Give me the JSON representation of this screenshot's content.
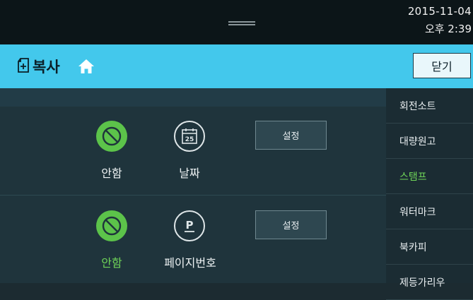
{
  "status": {
    "date": "2015-11-04",
    "time": "오후 2:39"
  },
  "header": {
    "title": "복사",
    "close_label": "닫기"
  },
  "stamp_rows": [
    {
      "none_label": "안함",
      "option_label": "날짜",
      "option_icon": "calendar-25-icon",
      "calendar_day": "25",
      "settings_label": "설정",
      "none_active": false
    },
    {
      "none_label": "안함",
      "option_label": "페이지번호",
      "option_icon": "page-number-p-icon",
      "page_symbol": "P",
      "settings_label": "설정",
      "none_active": true
    }
  ],
  "menu": {
    "items": [
      {
        "label": "회전소트"
      },
      {
        "label": "대량원고"
      },
      {
        "label": "스탬프",
        "active": true
      },
      {
        "label": "워터마크"
      },
      {
        "label": "북카피"
      },
      {
        "label": "제등가리우"
      }
    ]
  },
  "colors": {
    "accent": "#43c8ec",
    "active_green": "#5cc34a"
  }
}
